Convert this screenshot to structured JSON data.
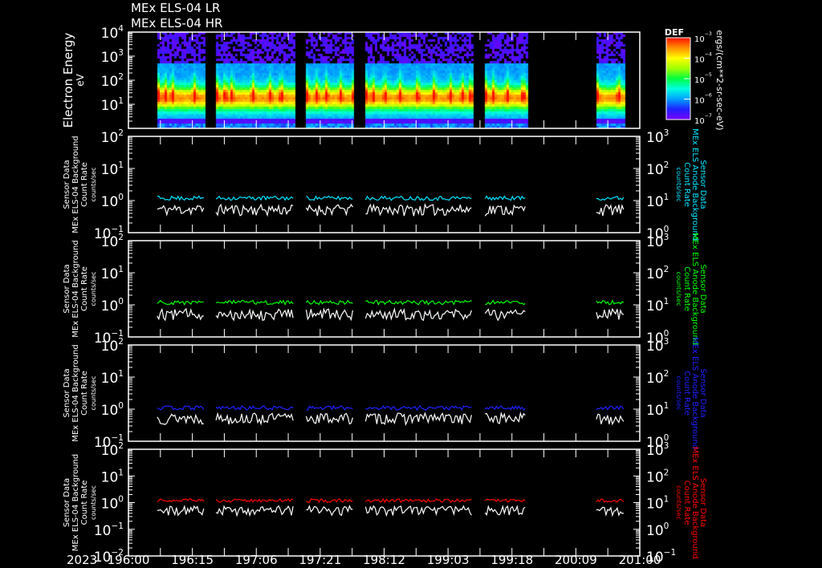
{
  "titles": [
    "MEx ELS-04 LR",
    "MEx ELS-04 HR"
  ],
  "chart_data": [
    {
      "type": "heatmap",
      "name": "electron-energy-spectrogram",
      "ylabel": "Electron Energy",
      "yunits": "eV",
      "ylim_log10": [
        0,
        4
      ],
      "ytick_exponents": [
        4,
        3,
        2,
        1
      ],
      "colorbar": {
        "title": "DEF",
        "units": "ergs/(cm**2-sr-sec-eV)",
        "range_log10": [
          -7,
          -3
        ],
        "tick_exponents": [
          -3,
          -4,
          -5,
          -6,
          -7
        ]
      },
      "peak_energy_eV": 20
    },
    {
      "type": "line",
      "name": "background-panel-cyan",
      "left_label": [
        "Sensor Data",
        "MEx ELS-04 Background",
        "Count Rate",
        "counts/sec"
      ],
      "right_label": [
        "Sensor Data",
        "MEx ELS Anode Background",
        "Count Rate",
        "counts/sec"
      ],
      "left_ylim_exp": [
        -1,
        2
      ],
      "right_ylim_exp": [
        0,
        3
      ],
      "color": "#00e5ff",
      "series": [
        {
          "name": "ELS-04 Background",
          "mean": 0.6,
          "color": "#ffffff"
        },
        {
          "name": "Anode Background",
          "mean": 1.2,
          "color": "#00e5ff"
        }
      ]
    },
    {
      "type": "line",
      "name": "background-panel-green",
      "left_label": [
        "Sensor Data",
        "MEx ELS-04 Background",
        "Count Rate",
        "counts/sec"
      ],
      "right_label": [
        "Sensor Data",
        "MEx ELS Anode Background",
        "Count Rate",
        "counts/sec"
      ],
      "left_ylim_exp": [
        -1,
        2
      ],
      "right_ylim_exp": [
        0,
        3
      ],
      "color": "#00ff00",
      "series": [
        {
          "name": "ELS-04 Background",
          "mean": 0.6,
          "color": "#ffffff"
        },
        {
          "name": "Anode Background",
          "mean": 1.2,
          "color": "#00ff00"
        }
      ]
    },
    {
      "type": "line",
      "name": "background-panel-blue",
      "left_label": [
        "Sensor Data",
        "MEx ELS-04 Background",
        "Count Rate",
        "counts/sec"
      ],
      "right_label": [
        "Sensor Data",
        "MEx ELS Anode Background",
        "Count Rate",
        "counts/sec"
      ],
      "left_ylim_exp": [
        -1,
        2
      ],
      "right_ylim_exp": [
        0,
        3
      ],
      "color": "#2020ff",
      "series": [
        {
          "name": "ELS-04 Background",
          "mean": 0.6,
          "color": "#ffffff"
        },
        {
          "name": "Anode Background",
          "mean": 1.1,
          "color": "#2020ff"
        }
      ]
    },
    {
      "type": "line",
      "name": "background-panel-red",
      "left_label": [
        "Sensor Data",
        "MEx ELS-04 Background",
        "Count Rate",
        "counts/sec"
      ],
      "right_label": [
        "Sensor Data",
        "MEx ELS Anode Background",
        "Count Rate",
        "counts/sec"
      ],
      "left_ylim_exp": [
        -2,
        2
      ],
      "right_ylim_exp": [
        -1,
        3
      ],
      "color": "#ff0000",
      "series": [
        {
          "name": "ELS-04 Background",
          "mean": 0.6,
          "color": "#ffffff"
        },
        {
          "name": "Anode Background",
          "mean": 1.2,
          "color": "#ff0000"
        }
      ]
    }
  ],
  "x_axis": {
    "year": "2023",
    "tick_labels": [
      "196:00",
      "196:15",
      "197:06",
      "197:21",
      "198:12",
      "199:03",
      "199:18",
      "200:09",
      "201:00"
    ],
    "data_segments": [
      [
        0.45,
        1.18
      ],
      [
        1.37,
        2.59
      ],
      [
        2.78,
        3.52
      ],
      [
        3.71,
        5.38
      ],
      [
        5.58,
        6.23
      ],
      [
        7.32,
        7.77
      ]
    ]
  }
}
